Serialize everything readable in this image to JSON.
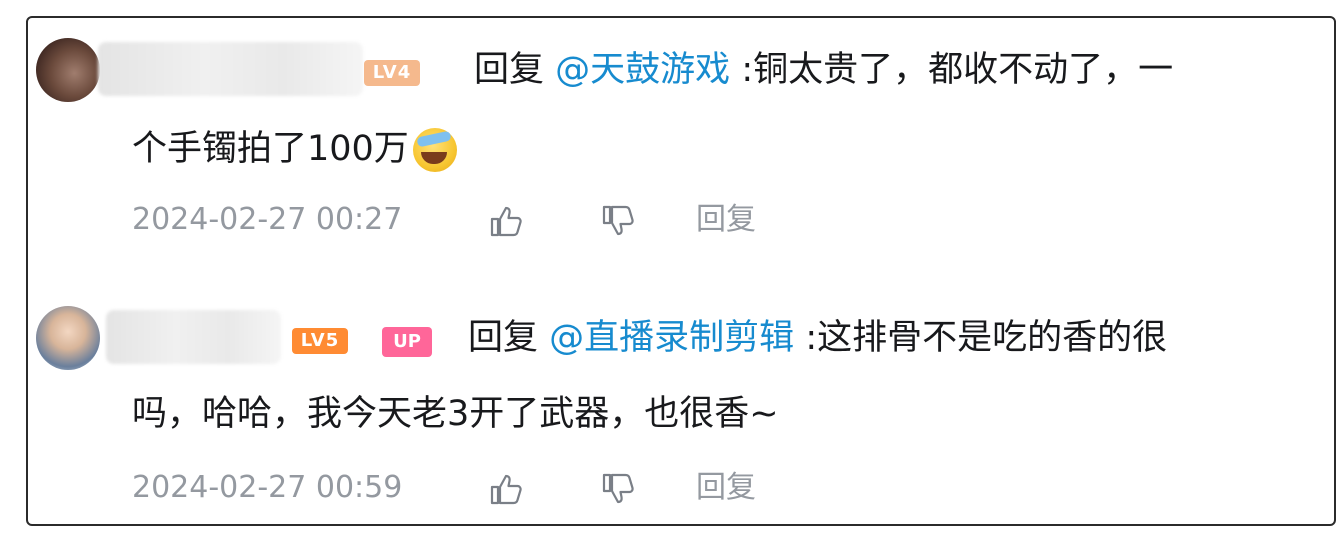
{
  "comments": [
    {
      "level_badge": "LV4",
      "reply_prefix": "回复",
      "mention": "@天鼓游戏",
      "text_line1": ":铜太贵了，都收不动了，一",
      "text_line2": "个手镯拍了100万",
      "emoji": "laughing-crying-emoji",
      "timestamp": "2024-02-27 00:27",
      "reply_label": "回复"
    },
    {
      "level_badge": "LV5",
      "up_badge": "UP",
      "reply_prefix": "回复",
      "mention": "@直播录制剪辑",
      "text_line1": ":这排骨不是吃的香的很",
      "text_line2": "吗，哈哈，我今天老3开了武器，也很香~",
      "timestamp": "2024-02-27 00:59",
      "reply_label": "回复"
    }
  ],
  "colors": {
    "mention": "#178bcf",
    "meta_text": "#9499a0",
    "lv4_badge": "#f5b98d",
    "lv5_badge": "#ff8b33",
    "up_badge": "#ff6699"
  }
}
